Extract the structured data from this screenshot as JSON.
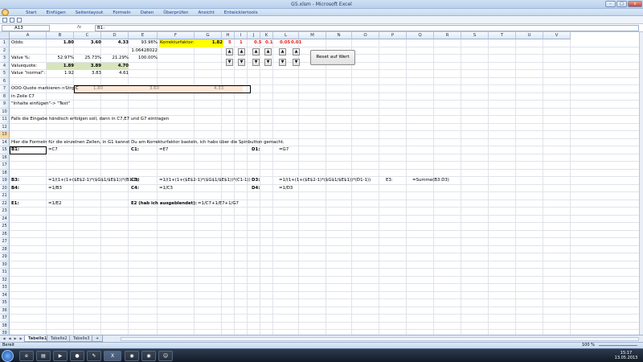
{
  "window": {
    "title": "G5.xlsm - Microsoft Excel",
    "min": "–",
    "max": "□",
    "close": "x"
  },
  "ribbon": {
    "tabs": [
      "Start",
      "Einfügen",
      "Seitenlayout",
      "Formeln",
      "Daten",
      "Überprüfen",
      "Ansicht",
      "Entwicklertools"
    ]
  },
  "formula_bar": {
    "name_box": "A13",
    "fx": "fx",
    "content": "B1:"
  },
  "columns": [
    "A",
    "B",
    "C",
    "D",
    "E",
    "F",
    "G",
    "H",
    "I",
    "J",
    "K",
    "L",
    "M",
    "N",
    "O",
    "P",
    "Q",
    "R",
    "S",
    "T",
    "U",
    "V"
  ],
  "rows": [
    "1",
    "2",
    "3",
    "4",
    "5",
    "6",
    "7",
    "8",
    "9",
    "10",
    "11",
    "12",
    "13",
    "14",
    "15",
    "16",
    "17",
    "18",
    "19",
    "20",
    "21",
    "22",
    "23",
    "24",
    "25",
    "26",
    "27",
    "28",
    "29",
    "30",
    "31",
    "32",
    "33",
    "34",
    "35",
    "36",
    "37",
    "38",
    "39",
    "40",
    "41"
  ],
  "cells": {
    "a1": "Odds:",
    "b1": "1.80",
    "c1": "3.60",
    "d1": "4.33",
    "e1": "93.96%",
    "f1": "Korrekturfaktor:",
    "g1": "1.82",
    "h1a": "5",
    "h1b": "1",
    "i1a": "0.5",
    "i1b": "0.1",
    "j1a": "0.05",
    "j1b": "0.01",
    "e2": "1.06428022",
    "a3": "Value %:",
    "b3": "52.97%",
    "c3": "25.73%",
    "d3": "21.29%",
    "e3": "100.00%",
    "a4": "Valuequote:",
    "b4": "1.89",
    "c4": "3.89",
    "d4": "4.70",
    "a5": "Value \"normal\":",
    "b5": "1.92",
    "c5": "3.83",
    "d5": "4.61",
    "a7": "OOO-Quote markieren->Strg C",
    "b7": "1.80",
    "c7": "3.60",
    "d7": "4.33",
    "a8": "in Zeile C7",
    "a9": "\"Inhalte einfügen\"-> \"Text\"",
    "a11": "Falls die Eingabe händisch erfolgen soll, dann in C7,E7 und G7 eintragen",
    "a14": "Hier die Formeln für die einzelnen Zellen, in G1 kannst Du am Korrekturfaktor basteln, ich habs über die Spinbutton gemacht.",
    "a15": "B1:",
    "b15": "=C7",
    "e15": "C1:",
    "f15": "=E7",
    "j15": "D1:",
    "k15": "=G7",
    "a17": "B3:",
    "b17": "=1/(1+(1+($E$2-1)*($G$1/$E$1))*(B1-1))",
    "e17": "C3:",
    "f17": "=1/(1+(1+($E$2-1)*($G$1/$E$1))*(C1-1))",
    "j17": "D3:",
    "k17": "=1/(1+(1+($E$2-1)*($G$1/$E$1))*(D1-1))",
    "n17": "E3:",
    "o17": "=Summe(B3:D3)",
    "a18": "B4:",
    "b18": "=1/B3",
    "e18": "C4:",
    "f18": "=1/C3",
    "j18": "D4:",
    "k18": "=1/D3",
    "a20": "E1:",
    "b20": "=1/E2",
    "e20": "E2 (hab ich ausgeblendet):",
    "f20": "=1/C7+1/E7+1/G7"
  },
  "spin_up": "▲",
  "spin_down": "▼",
  "reset_button": "Reset auf Wert",
  "sheets": [
    "Tabelle1",
    "Tabelle2",
    "Tabelle3"
  ],
  "status": {
    "ready": "Bereit",
    "zoom": "100 %"
  },
  "taskbar": {
    "time": "15:17",
    "date": "13.05.2013"
  },
  "colors": {
    "highlight_yellow": "#ffff00",
    "green_fill": "#d7e4bc",
    "peach_fill": "#fde9d9",
    "red_text": "#e02020"
  }
}
